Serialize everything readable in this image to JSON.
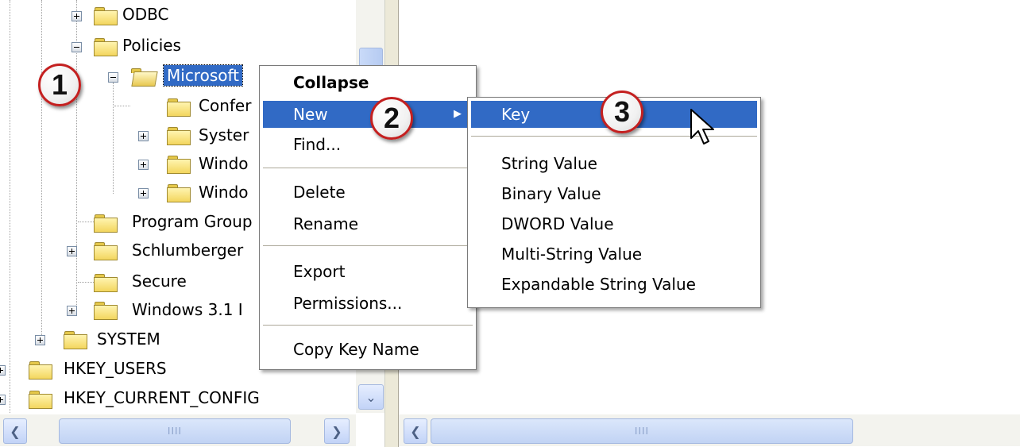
{
  "tree": {
    "items": [
      {
        "label": "ODBC",
        "expander": "plus"
      },
      {
        "label": "Policies",
        "expander": "minus"
      },
      {
        "label": "Microsoft",
        "expander": "minus",
        "selected": true
      },
      {
        "label": "Confer"
      },
      {
        "label": "Syster",
        "expander": "plus"
      },
      {
        "label": "Windo",
        "expander": "plus"
      },
      {
        "label": "Windo",
        "expander": "plus"
      },
      {
        "label": "Program Group"
      },
      {
        "label": "Schlumberger",
        "expander": "plus"
      },
      {
        "label": "Secure"
      },
      {
        "label": "Windows 3.1 I",
        "expander": "plus"
      },
      {
        "label": "SYSTEM",
        "expander": "plus"
      },
      {
        "label": "HKEY_USERS",
        "expander": "plus"
      },
      {
        "label": "HKEY_CURRENT_CONFIG",
        "expander": "plus"
      }
    ]
  },
  "context_menu": {
    "items": [
      {
        "label": "Collapse"
      },
      {
        "label": "New"
      },
      {
        "label": "Find..."
      },
      {
        "label": "Delete"
      },
      {
        "label": "Rename"
      },
      {
        "label": "Export"
      },
      {
        "label": "Permissions..."
      },
      {
        "label": "Copy Key Name"
      }
    ],
    "submenu_arrow": "▶"
  },
  "submenu": {
    "items": [
      {
        "label": "Key"
      },
      {
        "label": "String Value"
      },
      {
        "label": "Binary Value"
      },
      {
        "label": "DWORD Value"
      },
      {
        "label": "Multi-String Value"
      },
      {
        "label": "Expandable String Value"
      }
    ]
  },
  "callouts": [
    "1",
    "2",
    "3"
  ],
  "scrollbars": {
    "thumb_grip": "IIII",
    "left_arrow": "❮",
    "right_arrow": "❯",
    "down_arrow": "⌄"
  },
  "icons": {
    "folder": "folder-icon",
    "folder_open": "open-folder-icon",
    "cursor": "mouse-cursor-icon"
  },
  "colors": {
    "selection": "#316ac5",
    "callout_ring": "#c42020",
    "folder": "#f3d65e"
  }
}
